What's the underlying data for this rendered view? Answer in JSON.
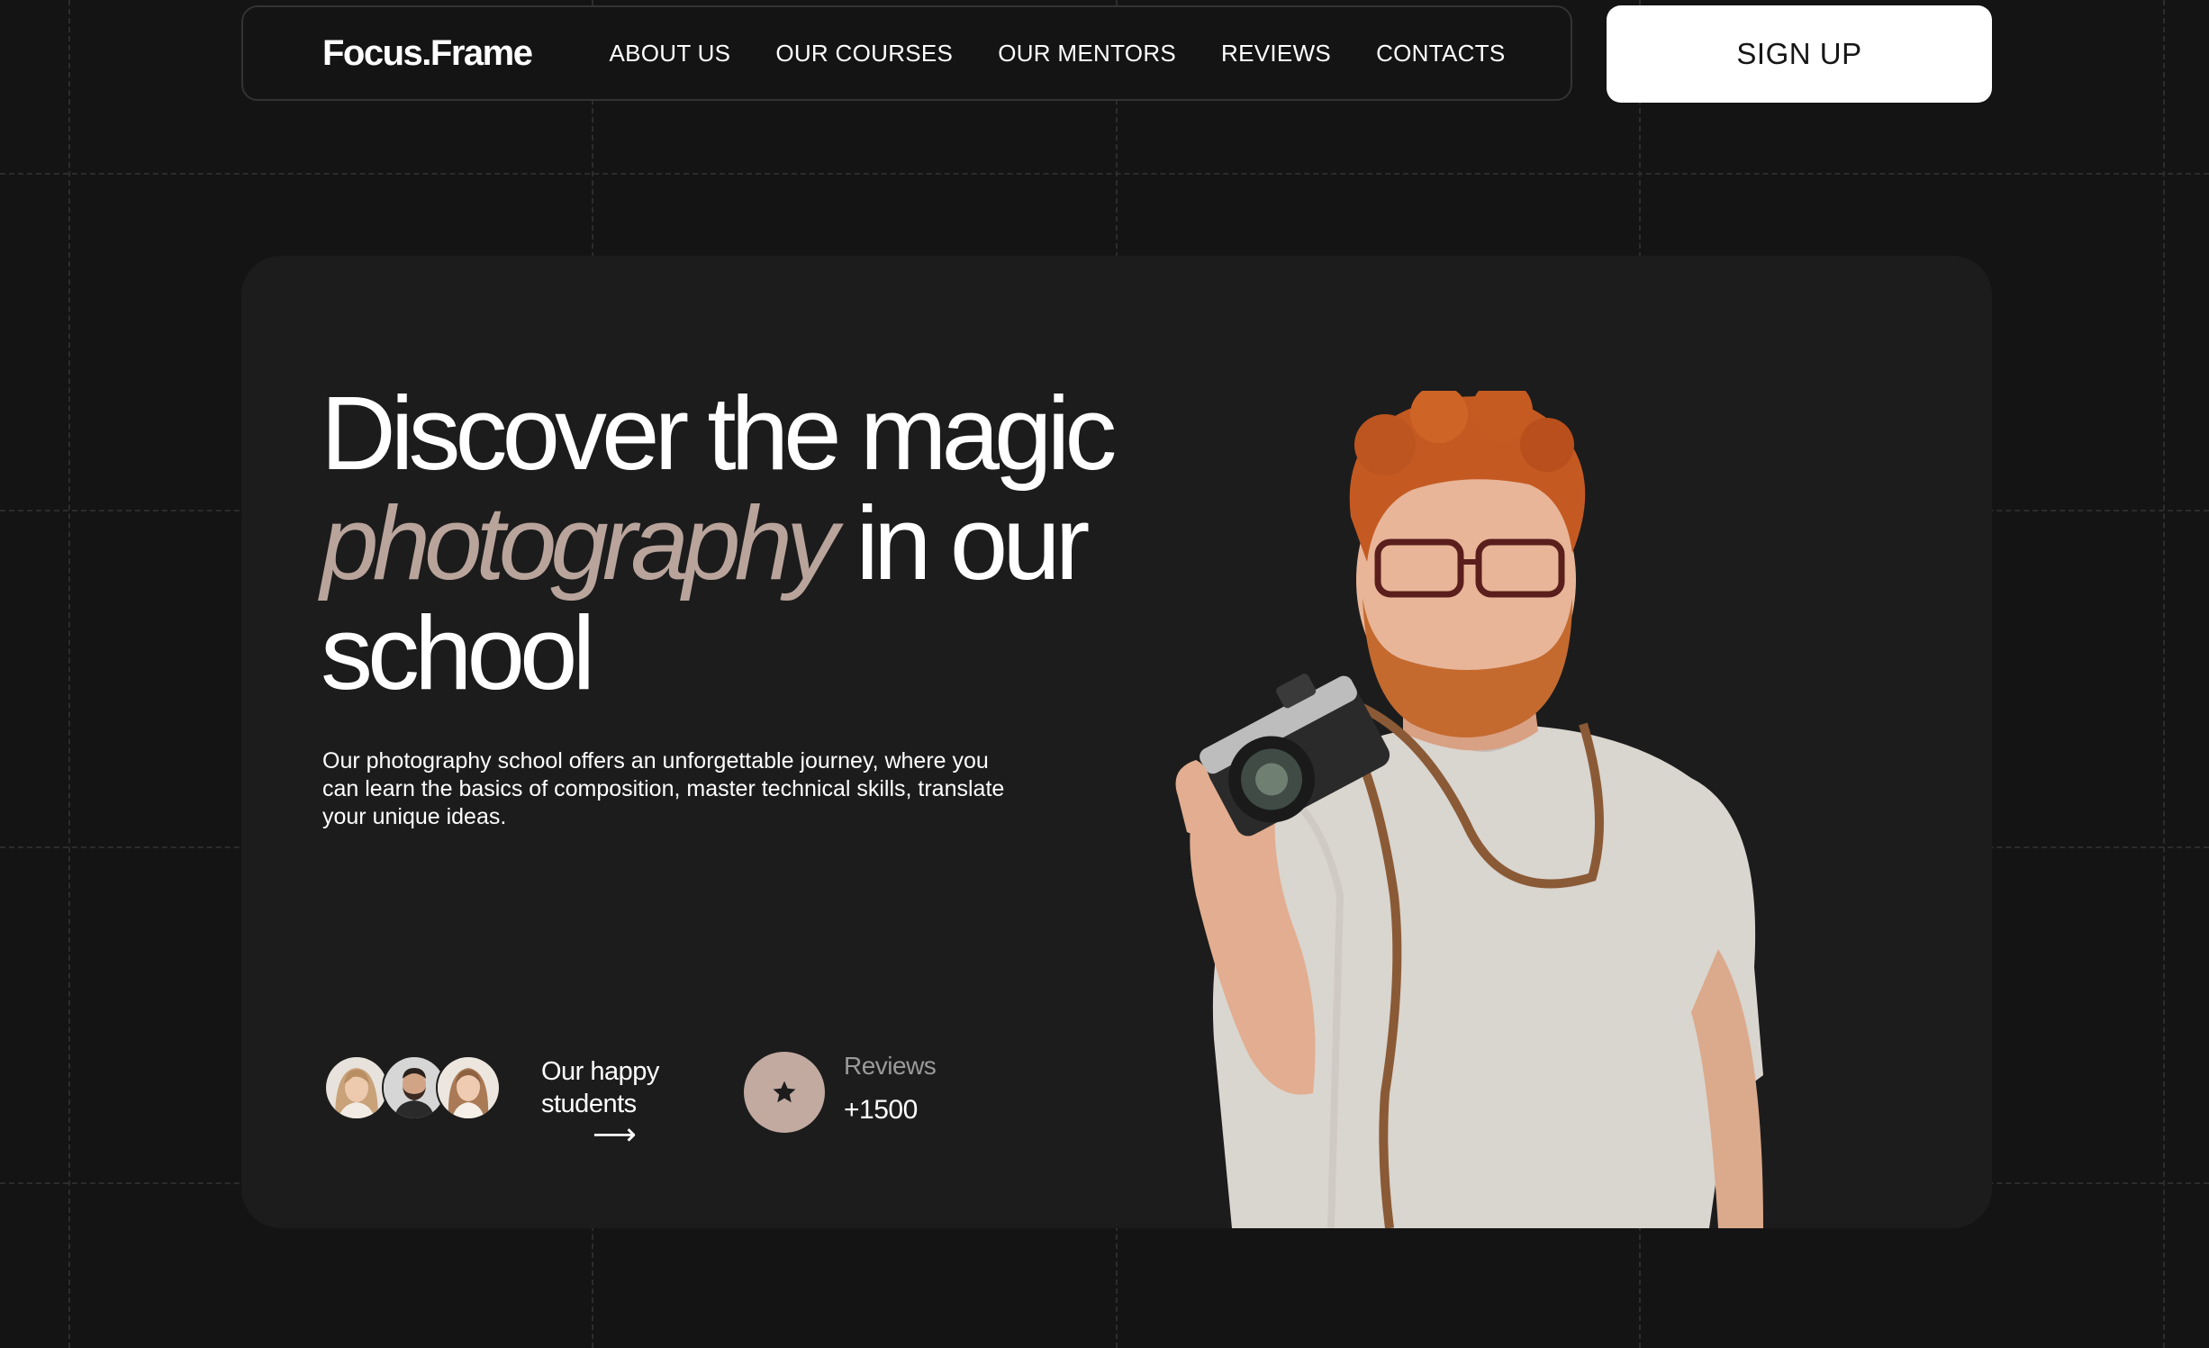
{
  "header": {
    "logo": "Focus.Frame",
    "nav": [
      "ABOUT US",
      "OUR COURSES",
      "OUR MENTORS",
      "REVIEWS",
      "CONTACTS"
    ],
    "signup_label": "SIGN UP"
  },
  "hero": {
    "headline_line1": "Discover the magic",
    "headline_accent": "photography",
    "headline_line2_rest": " in our",
    "headline_line3": "school",
    "description": "Our photography school offers an unforgettable journey, where you can learn the basics of composition, master technical skills, translate your unique ideas.",
    "students_label_line1": "Our happy",
    "students_label_line2": "students",
    "students_arrow": "⟶",
    "reviews_label": "Reviews",
    "reviews_count": "+1500"
  },
  "icons": {
    "avatars": [
      "avatar-woman-blonde",
      "avatar-man-beard",
      "avatar-woman-brunette"
    ],
    "badge_icon": "star-icon",
    "arrow_icon": "arrow-right-icon"
  },
  "colors": {
    "background": "#141414",
    "card": "#1c1c1c",
    "accent": "#b9a49c",
    "star_badge": "#c2aaa1",
    "button_bg": "#ffffff",
    "muted_text": "#9a9a9a"
  }
}
